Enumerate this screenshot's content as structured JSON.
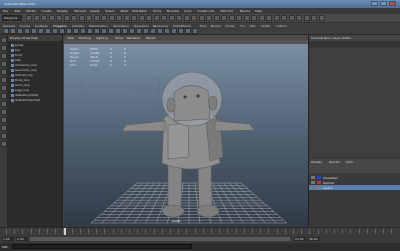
{
  "window": {
    "title": "Autodesk Maya 2011"
  },
  "menubar": {
    "items": [
      "File",
      "Edit",
      "Modify",
      "Create",
      "Display",
      "Window",
      "Assets",
      "Select",
      "Mesh",
      "Edit Mesh",
      "Proxy",
      "Normals",
      "Color",
      "Create UVs",
      "Edit UVs",
      "Muscle",
      "Help"
    ]
  },
  "status": {
    "menuset": "Polygons"
  },
  "shelf": {
    "tabs": [
      "General",
      "Curves",
      "Surfaces",
      "Polygons",
      "Subdivs",
      "Deformation",
      "Animation",
      "Dynamics",
      "Rendering",
      "PaintEffects",
      "Toon",
      "Muscle",
      "Fluids",
      "Fur",
      "Hair",
      "nCloth",
      "Custom"
    ],
    "active": 3
  },
  "outliner": {
    "header": "Display Show Help",
    "items": [
      "persp",
      "top",
      "front",
      "side",
      "Character_Grp",
      "Geometry_Grp",
      "Helmet_Grp",
      "Body_Grp",
      "Arms_Grp",
      "Legs_Grp",
      "defaultLightSet",
      "defaultObjectSet"
    ]
  },
  "viewport": {
    "menu": [
      "View",
      "Shading",
      "Lighting",
      "Show",
      "Renderer",
      "Panels"
    ],
    "camera_label": "persp",
    "channels": [
      {
        "name": "Verts:",
        "a": "5884",
        "b": "0",
        "c": "0"
      },
      {
        "name": "Edges:",
        "a": "11684",
        "b": "0",
        "c": "0"
      },
      {
        "name": "Faces:",
        "a": "5816",
        "b": "0",
        "c": "0"
      },
      {
        "name": "Tris:",
        "a": "11632",
        "b": "0",
        "c": "0"
      },
      {
        "name": "UVs:",
        "a": "6431",
        "b": "0",
        "c": "0"
      }
    ]
  },
  "right_panel": {
    "header": "Channel Box / Layer Editor",
    "tabs": [
      "Channels",
      "Edit",
      "Object",
      "Show"
    ],
    "layer_tabs": [
      "Display",
      "Render",
      "Anim"
    ],
    "layers": [
      {
        "name": "Character",
        "color": "#2a3fd0"
      },
      {
        "name": "Helmet",
        "color": "#d03030"
      },
      {
        "name": "layer1",
        "color": "#7d7d7d",
        "selected": true
      }
    ]
  },
  "timeline": {
    "start": "1.00",
    "end": "24.00",
    "range_end": "48.00"
  },
  "command": {
    "label": "MEL"
  },
  "colors": {
    "viewport_top": "#7f94a9",
    "viewport_bottom": "#2f3a46",
    "model": "#8a8a8a",
    "grid": "#b6b6b6",
    "selected_layer": "#5b7fb0"
  }
}
